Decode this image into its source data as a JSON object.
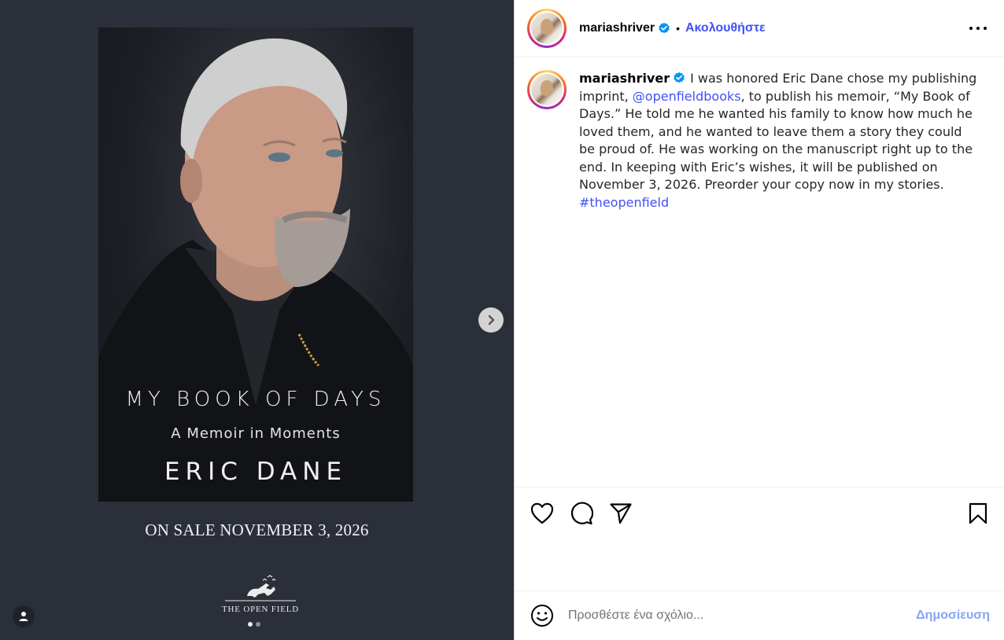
{
  "media": {
    "cover": {
      "title": "MY BOOK OF DAYS",
      "subtitle": "A Memoir in Moments",
      "author": "ERIC DANE"
    },
    "on_sale": "ON SALE NOVEMBER 3, 2026",
    "publisher_logo_text": "THE OPEN FIELD",
    "carousel": {
      "total": 2,
      "current": 1
    },
    "icons": {
      "next": "chevron-right-icon",
      "tag": "user-tag-icon"
    }
  },
  "header": {
    "username": "mariashriver",
    "verified": true,
    "separator": "•",
    "follow_label": "Ακολουθήστε",
    "more_icon": "more-options-icon"
  },
  "caption": {
    "username": "mariashriver",
    "text_1": "I was honored Eric Dane chose my publishing imprint, ",
    "mention": "@openfieldbooks",
    "text_2": ", to publish his memoir, “My Book of Days.” He told me he wanted his family to know how much he loved them, and he wanted to leave them a story they could be proud of. He was working on the manuscript right up to the end. In keeping with Eric’s wishes, it will be published on November 3, 2026. Preorder your copy now in my stories. ",
    "hashtag": "#theopenfield"
  },
  "actions": {
    "icons": [
      "heart-icon",
      "comment-icon",
      "share-icon",
      "bookmark-icon"
    ]
  },
  "comment": {
    "placeholder": "Προσθέστε ένα σχόλιο...",
    "post_label": "Δημοσίευση",
    "emoji_icon": "emoji-icon"
  },
  "colors": {
    "accent": "#4150f7",
    "post_button_disabled": "#85a6f5",
    "media_background": "#2b2f3a",
    "verified": "#0095f6"
  }
}
